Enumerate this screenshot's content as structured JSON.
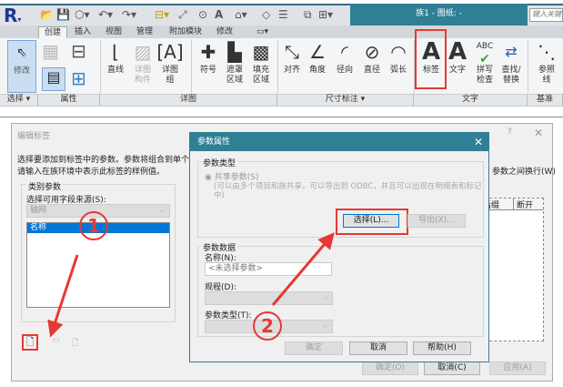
{
  "window": {
    "title": "族1 - 图纸: -",
    "search_placeholder": "键入关键"
  },
  "tabs": [
    "创建",
    "插入",
    "视图",
    "管理",
    "附加模块",
    "修改"
  ],
  "ribbon": {
    "modify": "修改",
    "tools": {
      "line": "直线",
      "detail_component": "详图构件",
      "detail_group": "详图组",
      "symbol": "符号",
      "masking_region": "遮罩区域",
      "filled_region": "填充区域",
      "aligned": "对齐",
      "angular": "角度",
      "radial": "径向",
      "diameter": "直径",
      "arc_length": "弧长",
      "label": "标签",
      "text": "文字",
      "spelling": "拼写检查",
      "find_replace": "查找/替换",
      "ref_line": "参照线"
    },
    "panels": [
      "选择 ▾",
      "属性",
      "详图",
      "尺寸标注 ▾",
      "文字",
      "基准"
    ]
  },
  "edit_label_dialog": {
    "title": "编辑标签",
    "help": "?",
    "desc1": "选择要添加到标签中的参数。参数将组合到单个标",
    "desc2": "请输入在族环境中表示此标签的样例值。",
    "line_break_text": "参数之间换行(W)",
    "category_group": "类别参数",
    "source_label": "选择可用字段来源(S):",
    "source_value": "轴网",
    "fields": [
      "名称"
    ],
    "columns": [
      "后缀",
      "断开"
    ],
    "ok": "确定(O)",
    "cancel": "取消(C)",
    "apply": "应用(A)"
  },
  "param_dialog": {
    "title": "参数属性",
    "type_group": "参数类型",
    "shared": "共享参数(S)",
    "shared_desc": "(可以由多个项目和族共享，可以导出到 ODBC，并且可以出现在明细表和标记中)",
    "select": "选择(L)...",
    "export": "导出(X)...",
    "data_group": "参数数据",
    "name_label": "名称(N):",
    "name_placeholder": "<未选择参数>",
    "discipline_label": "规程(D):",
    "type_label": "参数类型(T):",
    "ok": "确定",
    "cancel": "取消",
    "help": "帮助(H)"
  },
  "annotations": [
    "1",
    "2"
  ],
  "colors": {
    "accent": "#2f7f95",
    "highlight": "#e53935"
  }
}
